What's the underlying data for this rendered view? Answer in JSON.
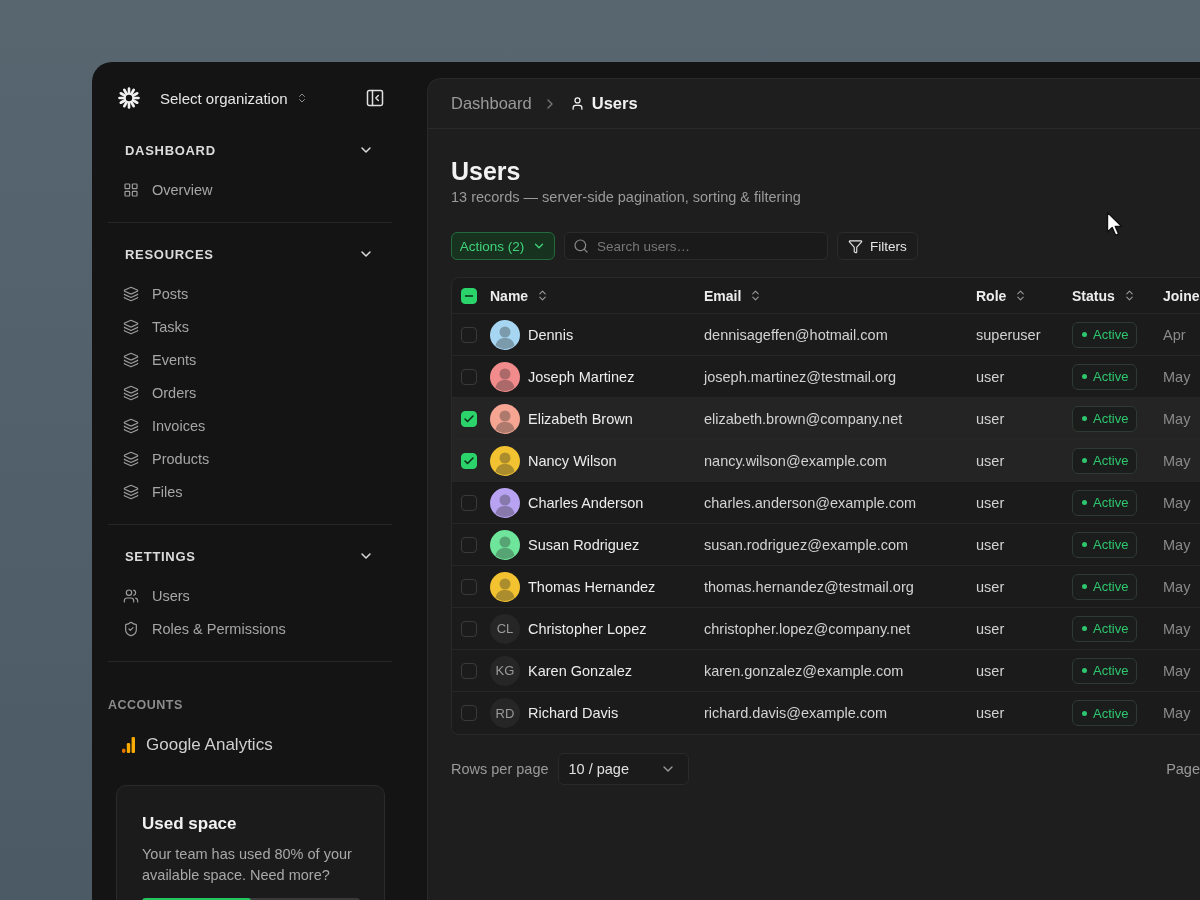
{
  "sidebar": {
    "organization": "Select organization",
    "sections": [
      {
        "title": "DASHBOARD",
        "expanded": true,
        "items": [
          {
            "label": "Overview",
            "kind": "overview",
            "selected": false
          }
        ]
      },
      {
        "title": "RESOURCES",
        "expanded": true,
        "items": [
          {
            "label": "Posts",
            "kind": "resource",
            "selected": false
          },
          {
            "label": "Tasks",
            "kind": "resource",
            "selected": false
          },
          {
            "label": "Events",
            "kind": "resource",
            "selected": false
          },
          {
            "label": "Orders",
            "kind": "resource",
            "selected": false
          },
          {
            "label": "Invoices",
            "kind": "resource",
            "selected": false
          },
          {
            "label": "Products",
            "kind": "resource",
            "selected": false
          },
          {
            "label": "Files",
            "kind": "resource",
            "selected": false
          }
        ]
      },
      {
        "title": "SETTINGS",
        "expanded": true,
        "items": [
          {
            "label": "Users",
            "kind": "people",
            "selected": false
          },
          {
            "label": "Roles & Permissions",
            "kind": "permissions",
            "selected": false
          }
        ]
      }
    ],
    "accounts": {
      "title": "ACCOUNTS",
      "items": [
        {
          "label": "Google Analytics"
        }
      ]
    },
    "usage_card": {
      "title": "Used space",
      "text": "Your team has used 80% of your available space. Need more?",
      "level": 0.5
    }
  },
  "breadcrumb": [
    {
      "label": "Dashboard",
      "current": false
    },
    {
      "label": "Users",
      "current": true
    }
  ],
  "page": {
    "title": "Users",
    "subtitle": "13 records — server-side pagination, sorting & filtering"
  },
  "toolbar": {
    "actions_button": "Actions (2)",
    "search": {
      "placeholder": "Search users…"
    },
    "filters_button": "Filters"
  },
  "table": {
    "select_all": {
      "indeterminate": true
    },
    "columns": [
      {
        "label": "Name",
        "sortable": true
      },
      {
        "label": "Email",
        "sortable": true
      },
      {
        "label": "Role",
        "sortable": true
      },
      {
        "label": "Status",
        "sortable": true
      },
      {
        "label": "Joine"
      }
    ],
    "rows": [
      {
        "name": "Dennis",
        "email": "dennisageffen@hotmail.com",
        "role": "superuser",
        "status": "Active",
        "joined": "Apr",
        "selected": false,
        "avatar": {
          "kind": "photo",
          "color": "#a7d6f2"
        }
      },
      {
        "name": "Joseph Martinez",
        "email": "joseph.martinez@testmail.org",
        "role": "user",
        "status": "Active",
        "joined": "May",
        "selected": false,
        "avatar": {
          "kind": "photo",
          "color": "#f28b8b"
        }
      },
      {
        "name": "Elizabeth Brown",
        "email": "elizabeth.brown@company.net",
        "role": "user",
        "status": "Active",
        "joined": "May",
        "selected": true,
        "avatar": {
          "kind": "photo",
          "color": "#f5a592"
        }
      },
      {
        "name": "Nancy Wilson",
        "email": "nancy.wilson@example.com",
        "role": "user",
        "status": "Active",
        "joined": "May",
        "selected": true,
        "avatar": {
          "kind": "photo",
          "color": "#f2c230"
        }
      },
      {
        "name": "Charles Anderson",
        "email": "charles.anderson@example.com",
        "role": "user",
        "status": "Active",
        "joined": "May",
        "selected": false,
        "avatar": {
          "kind": "photo",
          "color": "#b8a3f2"
        }
      },
      {
        "name": "Susan Rodriguez",
        "email": "susan.rodriguez@example.com",
        "role": "user",
        "status": "Active",
        "joined": "May",
        "selected": false,
        "avatar": {
          "kind": "photo",
          "color": "#6ee59a"
        }
      },
      {
        "name": "Thomas Hernandez",
        "email": "thomas.hernandez@testmail.org",
        "role": "user",
        "status": "Active",
        "joined": "May",
        "selected": false,
        "avatar": {
          "kind": "photo",
          "color": "#f2c230"
        }
      },
      {
        "name": "Christopher Lopez",
        "email": "christopher.lopez@company.net",
        "role": "user",
        "status": "Active",
        "joined": "May",
        "selected": false,
        "avatar": {
          "kind": "initials",
          "text": "CL"
        }
      },
      {
        "name": "Karen Gonzalez",
        "email": "karen.gonzalez@example.com",
        "role": "user",
        "status": "Active",
        "joined": "May",
        "selected": false,
        "avatar": {
          "kind": "initials",
          "text": "KG"
        }
      },
      {
        "name": "Richard Davis",
        "email": "richard.davis@example.com",
        "role": "user",
        "status": "Active",
        "joined": "May",
        "selected": false,
        "avatar": {
          "kind": "initials",
          "text": "RD"
        }
      }
    ]
  },
  "pagination": {
    "label": "Rows per page",
    "page_size": "10 / page",
    "page_label": "Page"
  }
}
